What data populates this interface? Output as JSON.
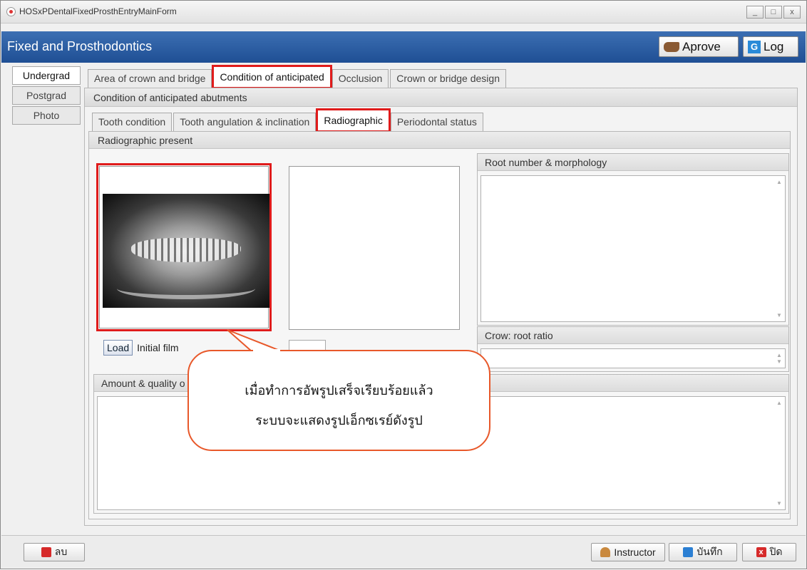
{
  "window": {
    "title": "HOSxPDentalFixedProsthEntryMainForm",
    "controls": {
      "minimize": "_",
      "maximize": "□",
      "close": "x"
    }
  },
  "header": {
    "title": "Fixed and Prosthodontics",
    "aprove_label": "Aprove",
    "log_label": "Log",
    "log_icon": "G"
  },
  "sidebar": {
    "items": [
      {
        "label": "Undergrad"
      },
      {
        "label": "Postgrad"
      },
      {
        "label": "Photo"
      }
    ]
  },
  "tabs": [
    {
      "label": "Area of crown and bridge"
    },
    {
      "label": "Condition of anticipated"
    },
    {
      "label": "Occlusion"
    },
    {
      "label": "Crown or bridge design"
    }
  ],
  "section_title": "Condition of anticipated abutments",
  "subtabs": [
    {
      "label": "Tooth condition"
    },
    {
      "label": "Tooth angulation & inclination"
    },
    {
      "label": "Radiographic"
    },
    {
      "label": "Periodontal status"
    }
  ],
  "radiographic": {
    "title": "Radiographic present",
    "load_label": "Load",
    "initial_label": "Initial film",
    "root_title": "Root number & morphology",
    "ratio_title": "Crow: root ratio",
    "amount_title": "Amount & quality o"
  },
  "callout": {
    "line1": "เมื่อทำการอัพรูปเสร็จเรียบร้อยแล้ว",
    "line2": "ระบบจะแสดงรูปเอ็กซเรย์ดังรูป"
  },
  "footer": {
    "delete_label": "ลบ",
    "instructor_label": "Instructor",
    "save_label": "บันทึก",
    "close_label": "ปิด",
    "close_icon": "x"
  },
  "colors": {
    "header_bg": "#1f4f94",
    "highlight": "#e01b1b",
    "callout_border": "#e8582a"
  },
  "icons": [
    "app-icon",
    "hand-icon",
    "log-icon",
    "delete-icon",
    "instructor-icon",
    "save-icon",
    "close-icon"
  ]
}
